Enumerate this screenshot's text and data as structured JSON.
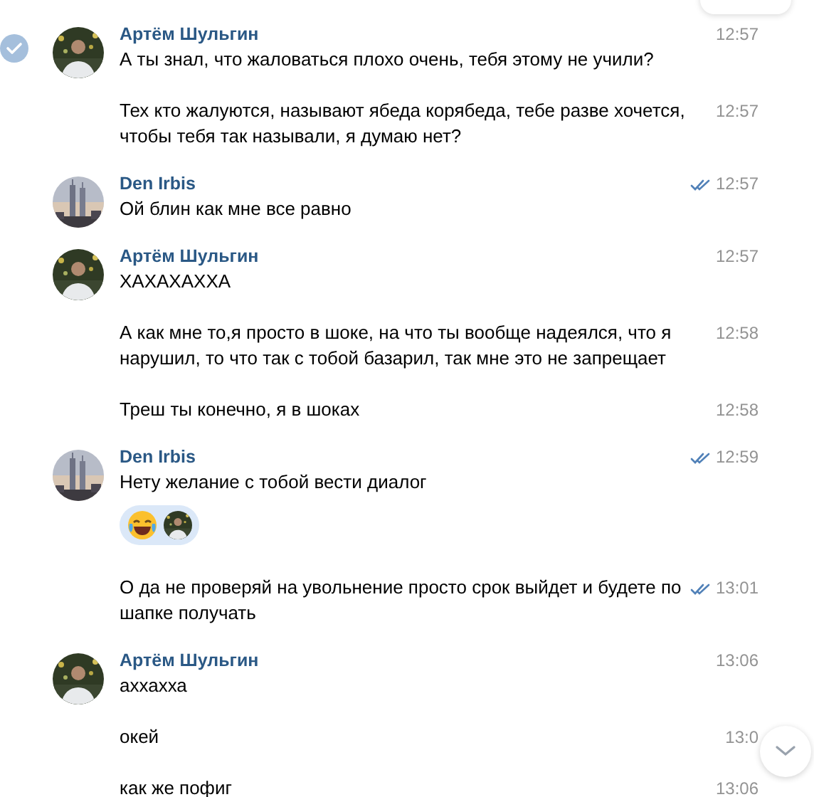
{
  "groups": [
    {
      "author": "Артём Шульгин",
      "avatar": {
        "kind": "person"
      },
      "messages": [
        {
          "text": "А ты знал, что жаловаться плохо очень, тебя этому не учили?",
          "time": "12:57",
          "read": false,
          "selected": true,
          "reaction": false
        },
        {
          "text": "Тех кто жалуются, называют ябеда корябеда, тебе разве хочется, чтобы тебя так называли, я думаю нет?",
          "time": "12:57",
          "read": false,
          "selected": false,
          "reaction": false
        }
      ]
    },
    {
      "author": "Den Irbis",
      "avatar": {
        "kind": "picture"
      },
      "messages": [
        {
          "text": "Ой блин как мне все равно",
          "time": "12:57",
          "read": true,
          "selected": false,
          "reaction": false
        }
      ]
    },
    {
      "author": "Артём Шульгин",
      "avatar": {
        "kind": "person"
      },
      "messages": [
        {
          "text": "ХАХАХАХХА",
          "time": "12:57",
          "read": false,
          "selected": false,
          "reaction": false
        },
        {
          "text": "А как мне то,я просто в шоке, на что ты вообще надеялся, что я нарушил, то что так с тобой базарил, так мне это не запрещает",
          "time": "12:58",
          "read": false,
          "selected": false,
          "reaction": false
        },
        {
          "text": "Треш ты конечно, я в шоках",
          "time": "12:58",
          "read": false,
          "selected": false,
          "reaction": false
        }
      ]
    },
    {
      "author": "Den Irbis",
      "avatar": {
        "kind": "picture"
      },
      "messages": [
        {
          "text": "Нету желание с тобой вести диалог",
          "time": "12:59",
          "read": true,
          "selected": false,
          "reaction": true
        },
        {
          "text": "О да не проверяй на увольнение просто срок выйдет и будете по шапке получать",
          "time": "13:01",
          "read": true,
          "selected": false,
          "reaction": false
        }
      ]
    },
    {
      "author": "Артём Шульгин",
      "avatar": {
        "kind": "person"
      },
      "messages": [
        {
          "text": "аххахха",
          "time": "13:06",
          "read": false,
          "selected": false,
          "reaction": false
        },
        {
          "text": "окей",
          "time": "13:0",
          "read": false,
          "selected": false,
          "reaction": false
        },
        {
          "text": "как же пофиг",
          "time": "13:06",
          "read": false,
          "selected": false,
          "reaction": false
        }
      ]
    }
  ]
}
